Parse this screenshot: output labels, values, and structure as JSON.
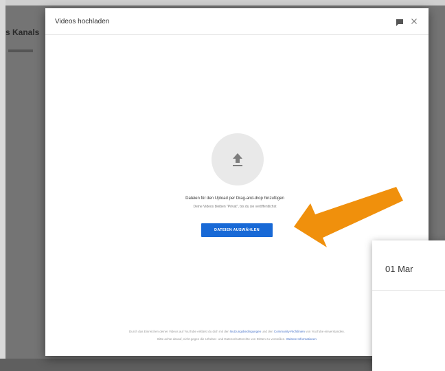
{
  "background": {
    "title_fragment": "s Kanals"
  },
  "dialog": {
    "title": "Videos hochladen",
    "feedback_icon": "feedback-icon",
    "close_icon": "close-icon"
  },
  "upload": {
    "icon": "upload-arrow-icon",
    "drop_hint": "Dateien für den Upload per Drag-and-drop hinzufügen",
    "privacy_hint": "Deine Videos bleiben \"Privat\", bis du sie veröffentlichst",
    "button_label": "DATEIEN AUSWÄHLEN"
  },
  "footer": {
    "line1_prefix": "Durch das Einreichen deiner Videos auf YouTube erklärst du dich mit den ",
    "terms_link": "Nutzungsbedingungen",
    "line1_middle": " und den ",
    "guidelines_link": "Community-Richtlinien",
    "line1_suffix": " von YouTube einverstanden.",
    "line2_prefix": "Bitte achte darauf, nicht gegen die Urheber- und Datenschutzrechte von Dritten zu verstoßen. ",
    "more_info_link": "Weitere Informationen"
  },
  "popup": {
    "title": "01 Mar"
  },
  "colors": {
    "primary_button": "#1869d6",
    "annotation_arrow": "#f0900c",
    "overlay": "#747474"
  }
}
